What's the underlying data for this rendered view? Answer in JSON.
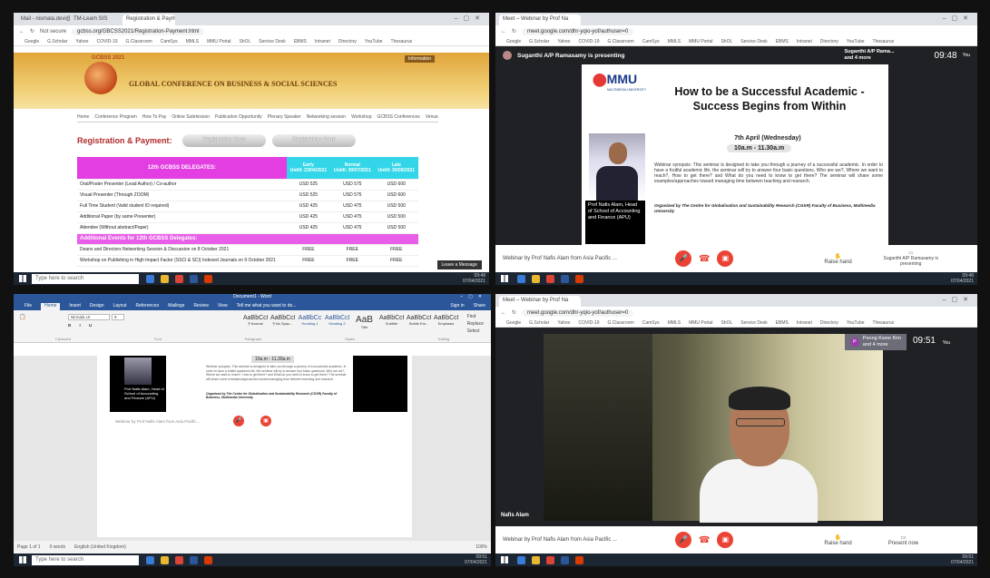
{
  "q1": {
    "tabs": [
      "Mail - nismala.devi@mmu.ed...",
      "TM-Learn SIS",
      "Registration & Payment"
    ],
    "url": "gcbss.org/GBCSS2021/Registration-Payment.html",
    "secure": "Not secure",
    "bookmarks": [
      "Google",
      "G.Scholar",
      "Yahoo",
      "COVID-19",
      "G.Classroom",
      "CamSys",
      "MMLS",
      "MMU Portal",
      "ShOL",
      "Service Desk",
      "EBMS",
      "Intranet",
      "Directory",
      "YouTube",
      "Thesaurus"
    ],
    "brand": "GCBSS 2021",
    "title": "GLOBAL CONFERENCE ON BUSINESS & SOCIAL SCIENCES",
    "info": "Information",
    "nav": [
      "Home",
      "Conference Program",
      "How To Pay",
      "Online Submission",
      "Publication Opportunity",
      "Plenary Speaker",
      "Networking session",
      "Workshop",
      "GCBSS Conferences",
      "Venue"
    ],
    "reg_title": "Registration & Payment:",
    "reg_form1": "Registration Form",
    "reg_form2": "Registration Form",
    "table": {
      "head": "12th GCBSS DELEGATES:",
      "cols": [
        [
          "Early",
          "Untill: 23/04/2021"
        ],
        [
          "Normal",
          "Untill: 30/07/2021"
        ],
        [
          "Late",
          "Untill: 30/09/2021"
        ]
      ],
      "rows": [
        [
          "Oral/Poster Presenter (Lead Author) / Co-author",
          "USD 525",
          "USD 575",
          "USD 600"
        ],
        [
          "Visual Presenter (Through ZOOM)",
          "USD 525",
          "USD 575",
          "USD 600"
        ],
        [
          "Full Time Student (Valid student ID required)",
          "USD 425",
          "USD 475",
          "USD 500"
        ],
        [
          "Additional Paper (by same Presenter)",
          "USD 425",
          "USD 475",
          "USD 500"
        ],
        [
          "Attendee (Without abstract/Paper)",
          "USD 425",
          "USD 475",
          "USD 500"
        ]
      ],
      "sec": "Additional Events for 12th GCBSS Delegates:",
      "rows2": [
        [
          "Deans and Directors Networking Session & Discussion on 8 October 2021",
          "FREE",
          "FREE",
          "FREE"
        ],
        [
          "Workshop on Publishing in High Impact Factor (SSCI & SCI) Indexed Journals on 9 October 2021",
          "FREE",
          "FREE",
          "FREE"
        ]
      ]
    },
    "leave": "Leave a Message",
    "search": "Type here to search",
    "time": "09:48",
    "date": "07/04/2021",
    "lang": "ENG"
  },
  "q2": {
    "tab": "Meet – Webinar by Prof Na",
    "url": "meet.google.com/dhr-yqio-yof/authuser=0",
    "presenting": "Suganthi A/P Ramasamy is presenting",
    "tile_name": "Suganthi A/P Rama...",
    "tile_more": "and 4 more",
    "clock": "09:48",
    "you": "You",
    "slide": {
      "logo": "MMU",
      "logo_sub": "MULTIMEDIA UNIVERSITY",
      "title": "How to be a Successful Academic - Success Begins from Within",
      "date": "7th April (Wednesday)",
      "time": "10a.m - 11.30a.m",
      "name": "Prof Nafis Alam, Head of School of Accounting and Finance (APU)",
      "synopsis": "Webinar synopsis: This seminar is designed to take you through a journey of a successful academic. In order to have a fruitful academic life, the seminar will try to answer four basic questions, Who are we?, Where we want to reach?, How to get there? and What do you need to know to get there? The seminar will share some examples/approaches toward managing time between teaching and research.",
      "org": "Organized by The Centre for Globalisation and Sustainability Research (CGSR) Faculty of Business, Multimedia University"
    },
    "meeting": "Webinar by Prof Nafis Alam from Asia Pacific ...",
    "raise": "Raise hand",
    "pres_by": "Suganthi A/P Ramasamy is presenting",
    "time": "09:48",
    "date": "07/04/2021"
  },
  "q3": {
    "title": "Document1 - Word",
    "tell": "Tell me what you want to do...",
    "signin": "Sign in",
    "share": "Share",
    "menu": [
      "File",
      "Home",
      "Insert",
      "Design",
      "Layout",
      "References",
      "Mailings",
      "Review",
      "View"
    ],
    "styles": [
      [
        "AaBbCcI",
        "¶ Normal"
      ],
      [
        "AaBbCcI",
        "¶ No Spac..."
      ],
      [
        "AaBbCc",
        "Heading 1"
      ],
      [
        "AaBbCcI",
        "Heading 2"
      ],
      [
        "AaB",
        "Title"
      ],
      [
        "AaBbCcI",
        "Subtitle"
      ],
      [
        "AaBbCcI",
        "Subtle Em..."
      ],
      [
        "AaBbCcI",
        "Emphasis"
      ]
    ],
    "font": "Nirmala UI",
    "size": "9",
    "find": "Find",
    "replace": "Replace",
    "select": "Select",
    "groups": [
      "Clipboard",
      "Font",
      "Paragraph",
      "Styles",
      "Editing"
    ],
    "page_name": "Prof Nafis Alam, Head of School of Accounting and Finance (APU)",
    "page_meeting": "Webinar by Prof Nafis Alam from Asia Pacific...",
    "page_time": "10a.m - 11.30a.m",
    "status": [
      "Page 1 of 1",
      "0 words",
      "English (United Kingdom)"
    ],
    "zoom": "100%",
    "search": "Type here to search",
    "time": "09:51",
    "date": "07/04/2021"
  },
  "q4": {
    "tab": "Meet – Webinar by Prof Na",
    "url": "meet.google.com/dhr-yqio-yof/authuser=0",
    "people": "Peong Kwee Kim",
    "more": "and 4 more",
    "clock": "09:51",
    "you": "You",
    "name": "Nafis Alam",
    "meeting": "Webinar by Prof Nafis Alam from Asia Pacific ...",
    "raise": "Raise hand",
    "present": "Present now",
    "time": "09:51",
    "date": "07/04/2021"
  }
}
